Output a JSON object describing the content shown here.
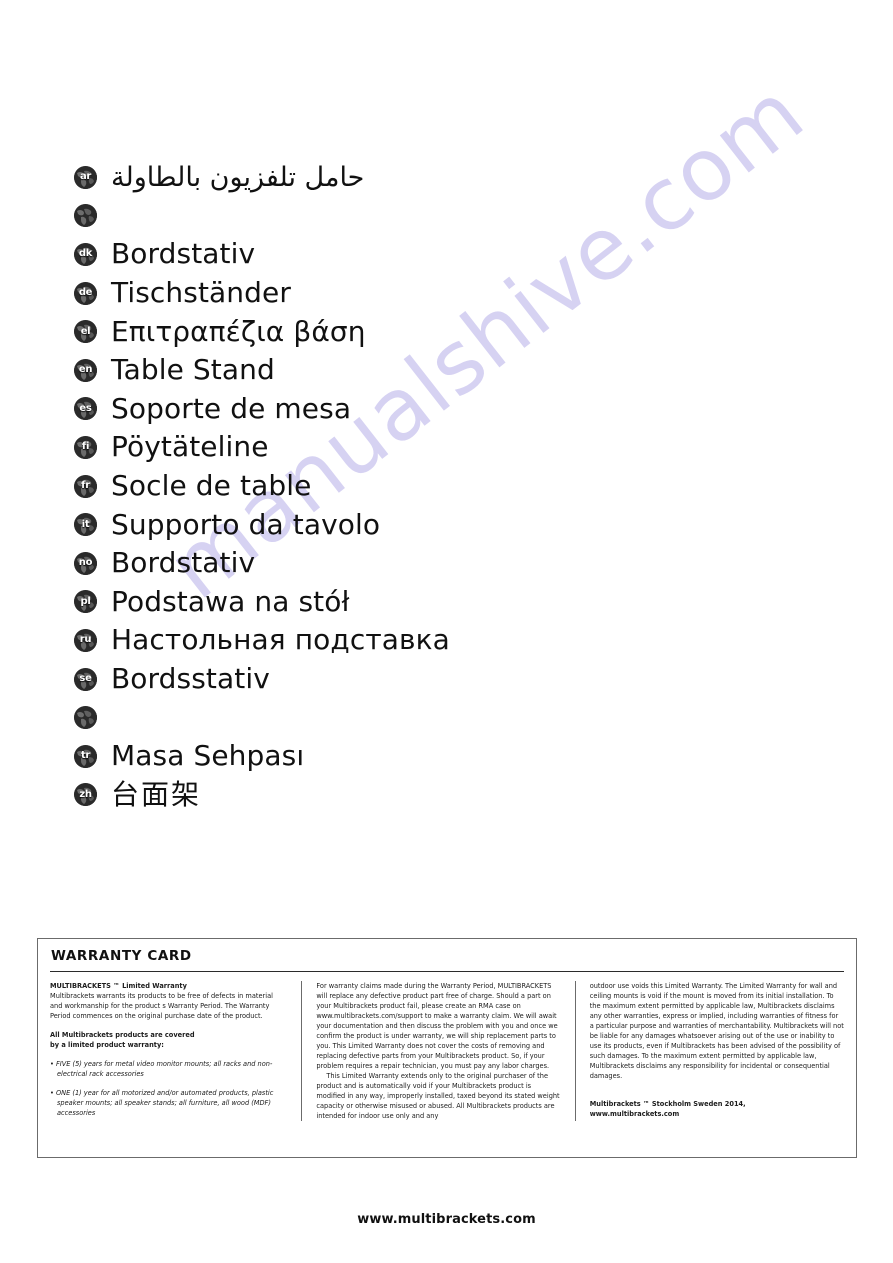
{
  "watermark": {
    "text": "manualshive.com",
    "color": "#cbc6ef"
  },
  "languages": [
    {
      "code": "ar",
      "label": "حامل تلفزيون بالطاولة",
      "dir": "rtl"
    },
    {
      "code": "",
      "label": "",
      "dir": "ltr"
    },
    {
      "code": "dk",
      "label": "Bordstativ",
      "dir": "ltr"
    },
    {
      "code": "de",
      "label": "Tischständer",
      "dir": "ltr"
    },
    {
      "code": "el",
      "label": "Επιτραπέζια βάση",
      "dir": "ltr"
    },
    {
      "code": "en",
      "label": "Table Stand",
      "dir": "ltr"
    },
    {
      "code": "es",
      "label": "Soporte de mesa",
      "dir": "ltr"
    },
    {
      "code": "fi",
      "label": "Pöytäteline",
      "dir": "ltr"
    },
    {
      "code": "fr",
      "label": "Socle de table",
      "dir": "ltr"
    },
    {
      "code": "it",
      "label": "Supporto da tavolo",
      "dir": "ltr"
    },
    {
      "code": "no",
      "label": "Bordstativ",
      "dir": "ltr"
    },
    {
      "code": "pl",
      "label": "Podstawa na stół",
      "dir": "ltr"
    },
    {
      "code": "ru",
      "label": "Настольная подставка",
      "dir": "ltr"
    },
    {
      "code": "se",
      "label": "Bordsstativ",
      "dir": "ltr"
    },
    {
      "code": "",
      "label": "",
      "dir": "ltr"
    },
    {
      "code": "tr",
      "label": "Masa Sehpası",
      "dir": "ltr"
    },
    {
      "code": "zh",
      "label": "台面架",
      "dir": "cjk"
    }
  ],
  "warranty": {
    "title": "WARRANTY CARD",
    "col1": {
      "heading": "MULTIBRACKETS ™ Limited Warranty",
      "intro": "Multibrackets warrants its products to be free of defects in material and workmanship for the product s Warranty Period. The Warranty Period commences on the original purchase date of the product.",
      "covered_line1": "All Multibrackets products are covered",
      "covered_line2": "by a limited product warranty:",
      "bullet1": "• FIVE (5) years for metal video monitor mounts; all racks and non-electrical rack accessories",
      "bullet2": "• ONE (1) year for all motorized and/or automated products, plastic speaker mounts; all speaker stands; all furniture, all wood (MDF) accessories"
    },
    "col2": {
      "para1": "For warranty claims made during the Warranty Period, MULTIBRACKETS will replace any defective product part free of charge. Should a part on your Multibrackets product fail, please create an RMA case on www.multibrackets.com/support to make a warranty claim. We will await your documentation and then discuss the problem with you and once we confirm the product is under warranty, we will ship replacement parts to you. This Limited Warranty does not cover the costs of removing and replacing defective parts from your Multibrackets product. So, if your problem requires a repair technician, you must pay any labor charges.",
      "para2": "This Limited Warranty extends only to the original purchaser of the product and is automatically void if your Multibrackets product is modified in any way, improperly installed, taxed beyond its stated weight capacity or otherwise misused or abused. All Multibrackets products are intended for indoor use only and any"
    },
    "col3": {
      "para1": "outdoor use voids this Limited Warranty. The Limited Warranty for wall and ceiling mounts is void if the mount is moved from its initial installation. To the maximum extent permitted by applicable law, Multibrackets disclaims any other warranties, express or implied, including warranties of fitness for a particular purpose and warranties of merchantability. Multibrackets will not be liable for any damages whatsoever arising out of the use or inability to use its products, even if Multibrackets has been advised of the possibility of such damages. To the maximum extent permitted by applicable law, Multibrackets disclaims any responsibility for incidental or consequential damages.",
      "address_line1": "Multibrackets ™ Stockholm Sweden 2014,",
      "address_line2": "www.multibrackets.com"
    }
  },
  "footer": {
    "url": "www.multibrackets.com"
  }
}
